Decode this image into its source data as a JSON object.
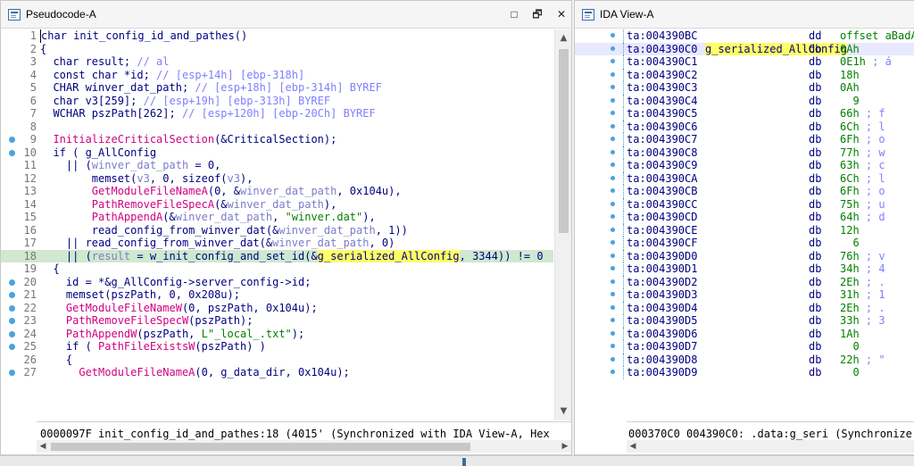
{
  "pseudocode": {
    "title": "Pseudocode-A",
    "controls": {
      "restore": "□",
      "maximize": "🗗",
      "close": "✕"
    },
    "lines": [
      {
        "n": "1",
        "dot": false,
        "segs": [
          [
            "kw",
            "char init_config_id_and_pathes()"
          ]
        ]
      },
      {
        "n": "2",
        "dot": false,
        "segs": [
          [
            "kw",
            "{"
          ]
        ]
      },
      {
        "n": "3",
        "dot": false,
        "segs": [
          [
            "kw",
            "  char result; "
          ],
          [
            "cm",
            "// al"
          ]
        ]
      },
      {
        "n": "4",
        "dot": false,
        "segs": [
          [
            "kw",
            "  const char *id; "
          ],
          [
            "cm",
            "// [esp+14h] [ebp-318h]"
          ]
        ]
      },
      {
        "n": "5",
        "dot": false,
        "segs": [
          [
            "kw",
            "  CHAR winver_dat_path; "
          ],
          [
            "cm",
            "// [esp+18h] [ebp-314h] BYREF"
          ]
        ]
      },
      {
        "n": "6",
        "dot": false,
        "segs": [
          [
            "kw",
            "  char v3[259]; "
          ],
          [
            "cm",
            "// [esp+19h] [ebp-313h] BYREF"
          ]
        ]
      },
      {
        "n": "7",
        "dot": false,
        "segs": [
          [
            "kw",
            "  WCHAR pszPath[262]; "
          ],
          [
            "cm",
            "// [esp+120h] [ebp-20Ch] BYREF"
          ]
        ]
      },
      {
        "n": "8",
        "dot": false,
        "segs": [
          [
            "kw",
            ""
          ]
        ]
      },
      {
        "n": "9",
        "dot": true,
        "segs": [
          [
            "fn",
            "  InitializeCriticalSection"
          ],
          [
            "kw",
            "(&CriticalSection);"
          ]
        ]
      },
      {
        "n": "10",
        "dot": true,
        "segs": [
          [
            "kw",
            "  if ( g_AllConfig"
          ]
        ]
      },
      {
        "n": "11",
        "dot": false,
        "segs": [
          [
            "kw",
            "    || ("
          ],
          [
            "lv",
            "winver_dat_path"
          ],
          [
            "kw",
            " = 0,"
          ]
        ]
      },
      {
        "n": "12",
        "dot": false,
        "segs": [
          [
            "kw",
            "        memset("
          ],
          [
            "lv",
            "v3"
          ],
          [
            "kw",
            ", 0, sizeof("
          ],
          [
            "lv",
            "v3"
          ],
          [
            "kw",
            "),"
          ]
        ]
      },
      {
        "n": "13",
        "dot": false,
        "segs": [
          [
            "fn",
            "        GetModuleFileNameA"
          ],
          [
            "kw",
            "(0, &"
          ],
          [
            "lv",
            "winver_dat_path"
          ],
          [
            "kw",
            ", 0x104u),"
          ]
        ]
      },
      {
        "n": "14",
        "dot": false,
        "segs": [
          [
            "fn",
            "        PathRemoveFileSpecA"
          ],
          [
            "kw",
            "(&"
          ],
          [
            "lv",
            "winver_dat_path"
          ],
          [
            "kw",
            "),"
          ]
        ]
      },
      {
        "n": "15",
        "dot": false,
        "segs": [
          [
            "fn",
            "        PathAppendA"
          ],
          [
            "kw",
            "(&"
          ],
          [
            "lv",
            "winver_dat_path"
          ],
          [
            "kw",
            ", "
          ],
          [
            "st",
            "\"winver.dat\""
          ],
          [
            "kw",
            "),"
          ]
        ]
      },
      {
        "n": "16",
        "dot": false,
        "segs": [
          [
            "kw",
            "        read_config_from_winver_dat(&"
          ],
          [
            "lv",
            "winver_dat_path"
          ],
          [
            "kw",
            ", 1))"
          ]
        ]
      },
      {
        "n": "17",
        "dot": false,
        "segs": [
          [
            "kw",
            "    || read_config_from_winver_dat(&"
          ],
          [
            "lv",
            "winver_dat_path"
          ],
          [
            "kw",
            ", 0)"
          ]
        ]
      },
      {
        "n": "18",
        "dot": false,
        "hl": true,
        "segs": [
          [
            "kw",
            "    || ("
          ],
          [
            "lv",
            "result"
          ],
          [
            "kw",
            " = w_init_config_and_set_id(&"
          ],
          [
            "gs",
            "g_serialized_AllConfig"
          ],
          [
            "kw",
            ", 3344)) != 0"
          ]
        ]
      },
      {
        "n": "19",
        "dot": false,
        "segs": [
          [
            "kw",
            "  {"
          ]
        ]
      },
      {
        "n": "20",
        "dot": true,
        "segs": [
          [
            "kw",
            "    id = *&g_AllConfig->server_config->id;"
          ]
        ]
      },
      {
        "n": "21",
        "dot": true,
        "segs": [
          [
            "kw",
            "    memset(pszPath, 0, 0x208u);"
          ]
        ]
      },
      {
        "n": "22",
        "dot": true,
        "segs": [
          [
            "fn",
            "    GetModuleFileNameW"
          ],
          [
            "kw",
            "(0, pszPath, 0x104u);"
          ]
        ]
      },
      {
        "n": "23",
        "dot": true,
        "segs": [
          [
            "fn",
            "    PathRemoveFileSpecW"
          ],
          [
            "kw",
            "(pszPath);"
          ]
        ]
      },
      {
        "n": "24",
        "dot": true,
        "segs": [
          [
            "fn",
            "    PathAppendW"
          ],
          [
            "kw",
            "(pszPath, "
          ],
          [
            "st",
            "L\"_local_.txt\""
          ],
          [
            "kw",
            ");"
          ]
        ]
      },
      {
        "n": "25",
        "dot": true,
        "segs": [
          [
            "kw",
            "    if ( "
          ],
          [
            "fn",
            "PathFileExistsW"
          ],
          [
            "kw",
            "(pszPath) )"
          ]
        ]
      },
      {
        "n": "26",
        "dot": false,
        "segs": [
          [
            "kw",
            "    {"
          ]
        ]
      },
      {
        "n": "27",
        "dot": true,
        "segs": [
          [
            "fn",
            "      GetModuleFileNameA"
          ],
          [
            "kw",
            "(0, g_data_dir, 0x104u);"
          ]
        ]
      }
    ],
    "status": "0000097F init_config_id_and_pathes:18 (4015' (Synchronized with IDA View-A, Hex"
  },
  "ida": {
    "title": "IDA View-A",
    "lines": [
      {
        "addr": "ta:004390BC",
        "name": "",
        "op": "dd",
        "val": "offset aBadAll",
        "cmt": ""
      },
      {
        "addr": "ta:004390C0",
        "name": "g_serialized_AllConfig",
        "op": "db",
        "val": "0Ah",
        "cmt": "",
        "sel": true
      },
      {
        "addr": "ta:004390C1",
        "name": "",
        "op": "db",
        "val": "0E1h",
        "cmt": " ; á"
      },
      {
        "addr": "ta:004390C2",
        "name": "",
        "op": "db",
        "val": "18h",
        "cmt": ""
      },
      {
        "addr": "ta:004390C3",
        "name": "",
        "op": "db",
        "val": "0Ah",
        "cmt": ""
      },
      {
        "addr": "ta:004390C4",
        "name": "",
        "op": "db",
        "val": "  9",
        "cmt": ""
      },
      {
        "addr": "ta:004390C5",
        "name": "",
        "op": "db",
        "val": "66h",
        "cmt": " ; f"
      },
      {
        "addr": "ta:004390C6",
        "name": "",
        "op": "db",
        "val": "6Ch",
        "cmt": " ; l"
      },
      {
        "addr": "ta:004390C7",
        "name": "",
        "op": "db",
        "val": "6Fh",
        "cmt": " ; o"
      },
      {
        "addr": "ta:004390C8",
        "name": "",
        "op": "db",
        "val": "77h",
        "cmt": " ; w"
      },
      {
        "addr": "ta:004390C9",
        "name": "",
        "op": "db",
        "val": "63h",
        "cmt": " ; c"
      },
      {
        "addr": "ta:004390CA",
        "name": "",
        "op": "db",
        "val": "6Ch",
        "cmt": " ; l"
      },
      {
        "addr": "ta:004390CB",
        "name": "",
        "op": "db",
        "val": "6Fh",
        "cmt": " ; o"
      },
      {
        "addr": "ta:004390CC",
        "name": "",
        "op": "db",
        "val": "75h",
        "cmt": " ; u"
      },
      {
        "addr": "ta:004390CD",
        "name": "",
        "op": "db",
        "val": "64h",
        "cmt": " ; d"
      },
      {
        "addr": "ta:004390CE",
        "name": "",
        "op": "db",
        "val": "12h",
        "cmt": ""
      },
      {
        "addr": "ta:004390CF",
        "name": "",
        "op": "db",
        "val": "  6",
        "cmt": ""
      },
      {
        "addr": "ta:004390D0",
        "name": "",
        "op": "db",
        "val": "76h",
        "cmt": " ; v"
      },
      {
        "addr": "ta:004390D1",
        "name": "",
        "op": "db",
        "val": "34h",
        "cmt": " ; 4"
      },
      {
        "addr": "ta:004390D2",
        "name": "",
        "op": "db",
        "val": "2Eh",
        "cmt": " ; ."
      },
      {
        "addr": "ta:004390D3",
        "name": "",
        "op": "db",
        "val": "31h",
        "cmt": " ; 1"
      },
      {
        "addr": "ta:004390D4",
        "name": "",
        "op": "db",
        "val": "2Eh",
        "cmt": " ; ."
      },
      {
        "addr": "ta:004390D5",
        "name": "",
        "op": "db",
        "val": "33h",
        "cmt": " ; 3"
      },
      {
        "addr": "ta:004390D6",
        "name": "",
        "op": "db",
        "val": "1Ah",
        "cmt": ""
      },
      {
        "addr": "ta:004390D7",
        "name": "",
        "op": "db",
        "val": "  0",
        "cmt": ""
      },
      {
        "addr": "ta:004390D8",
        "name": "",
        "op": "db",
        "val": "22h",
        "cmt": " ; \""
      },
      {
        "addr": "ta:004390D9",
        "name": "",
        "op": "db",
        "val": "  0",
        "cmt": ""
      }
    ],
    "status": "000370C0 004390C0: .data:g_seri (Synchronize"
  },
  "colors": {
    "keyword": "#000080",
    "comment": "#7f7fff",
    "function": "#d00080",
    "string": "#008000",
    "highlight_line": "#cfe8cf",
    "highlight_symbol": "#ffff66",
    "breakpoint_dot": "#4aa3df"
  }
}
